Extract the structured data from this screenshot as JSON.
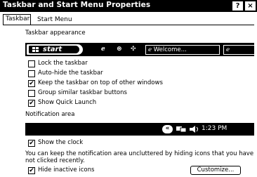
{
  "window": {
    "title": "Taskbar and Start Menu Properties",
    "help_glyph": "?",
    "close_glyph": "×"
  },
  "tabs": [
    {
      "label": "Taskbar",
      "active": true
    },
    {
      "label": "Start Menu",
      "active": false
    }
  ],
  "taskbar_appearance": {
    "group_label": "Taskbar appearance",
    "preview": {
      "start_label": "start",
      "task_button_label": "Welcome..."
    },
    "options": [
      {
        "label": "Lock the taskbar",
        "checked": false
      },
      {
        "label": "Auto-hide the taskbar",
        "checked": false
      },
      {
        "label": "Keep the taskbar on top of other windows",
        "checked": true
      },
      {
        "label": "Group similar taskbar buttons",
        "checked": false
      },
      {
        "label": "Show Quick Launch",
        "checked": true
      }
    ]
  },
  "notification_area": {
    "group_label": "Notification area",
    "preview": {
      "chevron": "«",
      "clock": "1:23 PM"
    },
    "show_clock": {
      "label": "Show the clock",
      "checked": true
    },
    "description": "You can keep the notification area uncluttered by hiding icons that you have not clicked recently.",
    "hide_inactive": {
      "label": "Hide inactive icons",
      "checked": true
    },
    "customize_label": "Customize..."
  },
  "check_glyph": "✔"
}
